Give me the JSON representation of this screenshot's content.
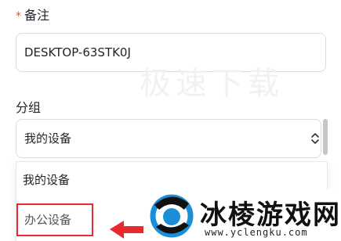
{
  "form": {
    "remark": {
      "required_mark": "*",
      "label": "备注",
      "value": "DESKTOP-63STK0J"
    },
    "group": {
      "label": "分组",
      "selected": "我的设备",
      "options": [
        {
          "label": "我的设备"
        },
        {
          "label": "办公设备"
        }
      ]
    }
  },
  "watermark": {
    "text": "极速下载"
  },
  "brand": {
    "name": "冰棱游戏网",
    "url": "www.yclengku.com"
  },
  "colors": {
    "required": "#f04b3c",
    "highlight_box": "#e8292e",
    "arrow": "#e8292e",
    "logo_blue": "#1a8fd8"
  },
  "icons": {
    "select_chevron": "chevron-up-down-icon",
    "arrow": "red-arrow-left-icon",
    "logo": "circle-logo-icon"
  }
}
